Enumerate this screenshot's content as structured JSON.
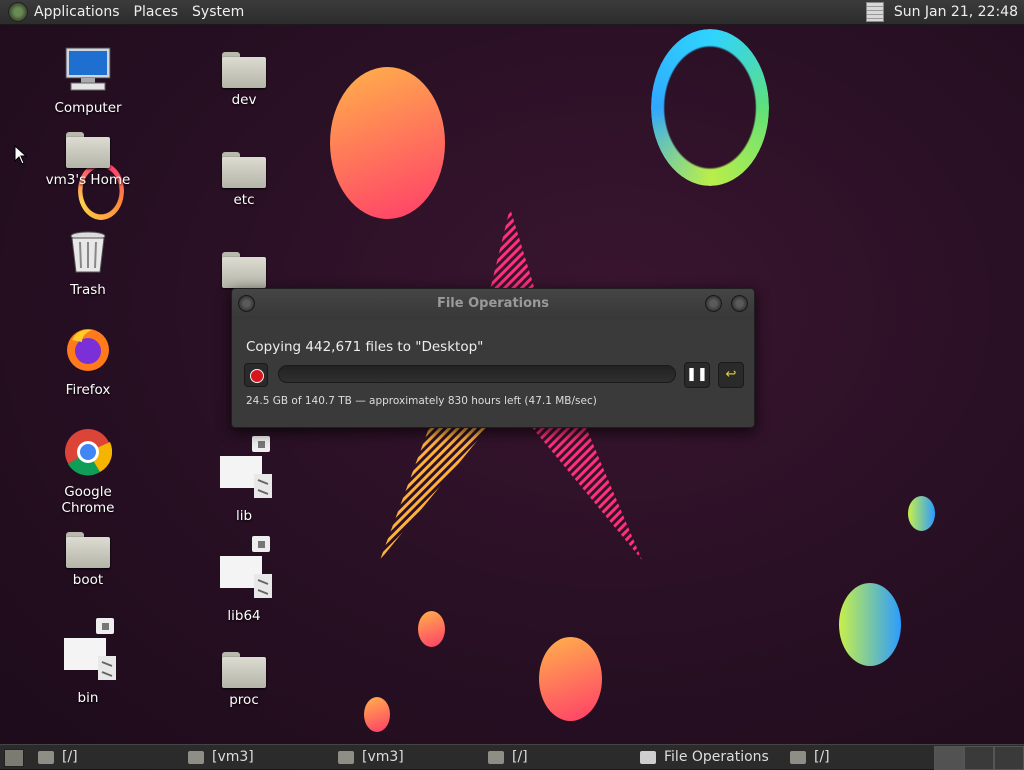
{
  "top_panel": {
    "menus": [
      "Applications",
      "Places",
      "System"
    ],
    "clock": "Sun Jan 21, 22:48"
  },
  "desktop_icons": [
    {
      "label": "Computer",
      "icon": "computer-icon"
    },
    {
      "label": "vm3's Home",
      "icon": "home-folder-icon"
    },
    {
      "label": "Trash",
      "icon": "trash-icon"
    },
    {
      "label": "Firefox",
      "icon": "firefox-icon"
    },
    {
      "label": "Google Chrome",
      "icon": "chrome-icon"
    },
    {
      "label": "boot",
      "icon": "folder-icon"
    },
    {
      "label": "bin",
      "icon": "symlink-icon"
    },
    {
      "label": "dev",
      "icon": "folder-icon"
    },
    {
      "label": "etc",
      "icon": "folder-icon"
    },
    {
      "label": "lib",
      "icon": "symlink-icon"
    },
    {
      "label": "lib64",
      "icon": "symlink-icon"
    },
    {
      "label": "proc",
      "icon": "folder-icon"
    }
  ],
  "dialog": {
    "title": "File Operations",
    "copying": "Copying 442,671 files to \"Desktop\"",
    "status": "24.5 GB of 140.7 TB — approximately 830 hours left (47.1 MB/sec)",
    "progress_fraction": 0.0002,
    "pause_icon": "pause-icon",
    "cancel_icon": "undo-icon"
  },
  "taskbar": {
    "items": [
      {
        "label": "[/]",
        "icon": "folder-icon"
      },
      {
        "label": "[vm3]",
        "icon": "folder-icon"
      },
      {
        "label": "[vm3]",
        "icon": "home-folder-icon"
      },
      {
        "label": "[/]",
        "icon": "folder-icon"
      },
      {
        "label": "File Operations",
        "icon": "file-ops-icon"
      },
      {
        "label": "[/]",
        "icon": "folder-icon"
      }
    ]
  },
  "colors": {
    "accent_red": "#d8141c",
    "panel": "#2b2b2b"
  }
}
